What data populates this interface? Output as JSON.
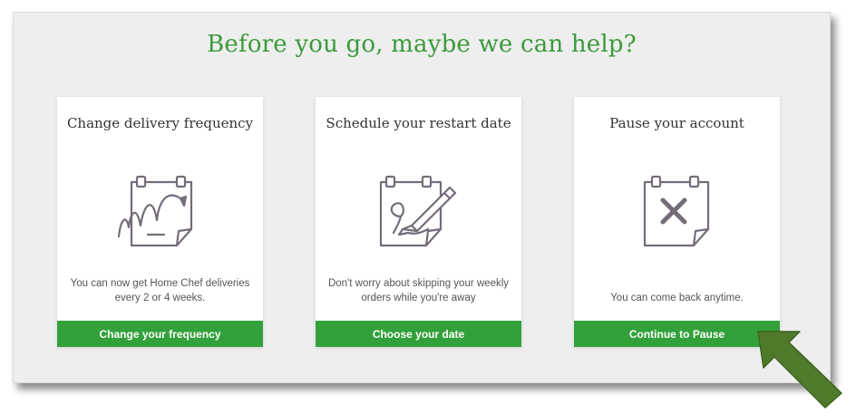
{
  "heading": "Before you go, maybe we can help?",
  "colors": {
    "accent_green": "#33a13b",
    "heading_green": "#3a9a3c",
    "arrow_green": "#4f7a2a",
    "icon_stroke": "#756c7a"
  },
  "cards": [
    {
      "title": "Change delivery frequency",
      "icon": "calendar-bounce-arrow-icon",
      "description": "You can now get Home Chef deliveries every 2 or 4 weeks.",
      "button_label": "Change your frequency"
    },
    {
      "title": "Schedule your restart date",
      "icon": "calendar-pencil-icon",
      "description": "Don't worry about skipping your weekly orders while you're away",
      "button_label": "Choose your date"
    },
    {
      "title": "Pause your account",
      "icon": "calendar-x-icon",
      "description": "You can come back anytime.",
      "button_label": "Continue to Pause"
    }
  ],
  "annotation": {
    "icon": "pointer-arrow-icon",
    "target": "continue-to-pause-button"
  }
}
